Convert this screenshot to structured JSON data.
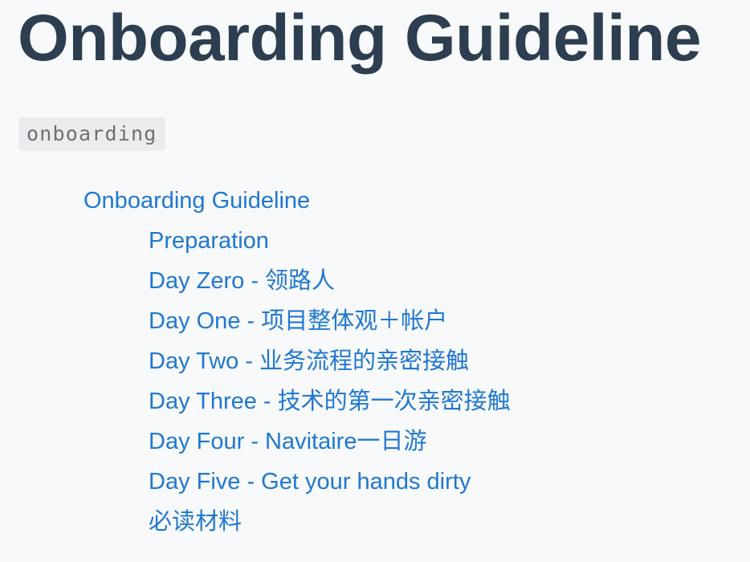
{
  "header": {
    "title": "Onboarding Guideline"
  },
  "tag": {
    "label": "onboarding"
  },
  "toc": {
    "top": "Onboarding Guideline",
    "items": [
      "Preparation",
      "Day Zero - 领路人",
      "Day One - 项目整体观＋帐户",
      "Day Two - 业务流程的亲密接触",
      "Day Three - 技术的第一次亲密接触",
      "Day Four - Navitaire一日游",
      "Day Five - Get your hands dirty",
      "必读材料"
    ]
  },
  "colors": {
    "title": "#2c3e50",
    "link": "#1f78d1",
    "tag_bg": "#eaecef",
    "tag_text": "#707070",
    "background": "#f8f9fb"
  }
}
